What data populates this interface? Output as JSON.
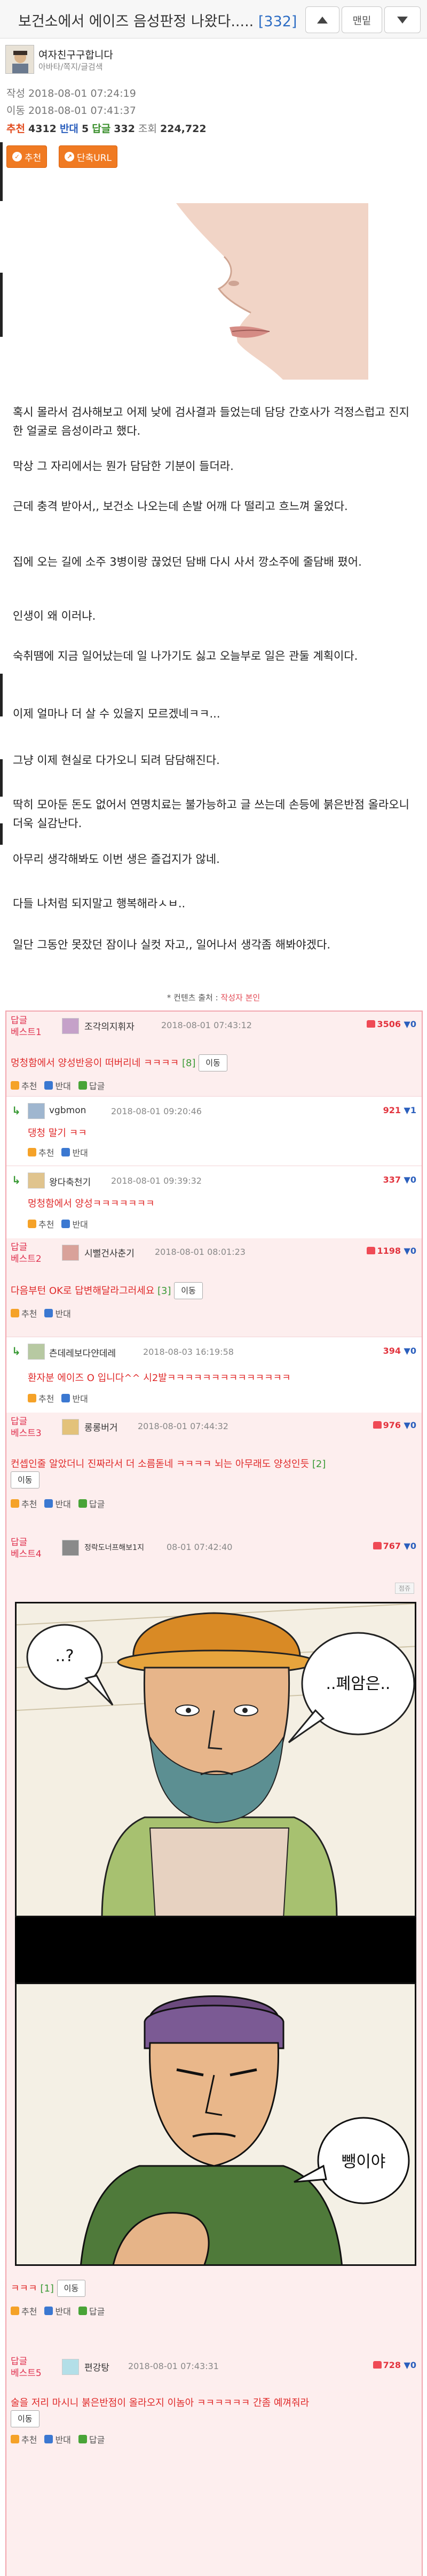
{
  "header": {
    "title": "보건소에서 에이즈 음성판정 나왔다.....",
    "comment_count": "[332]",
    "bottom_button": "맨밑"
  },
  "post": {
    "author": "여자친구구합니다",
    "author_sub": "아바타/쪽지/글검색",
    "created": "작성 2018-08-01 07:24:19",
    "moved": "이동 2018-08-01 07:41:37",
    "stats": {
      "rec_label": "추천",
      "rec_value": "4312",
      "opp_label": "반대",
      "opp_value": "5",
      "reply_label": "답글",
      "reply_value": "332",
      "view_label": "조회",
      "view_value": "224,722"
    },
    "recommend_button": "추천",
    "short_url_button": "단축URL",
    "paragraphs": [
      "혹시 몰라서 검사해보고 어제 낮에 검사결과 들었는데 담당 간호사가 걱정스럽고 진지한 얼굴로 음성이라고 했다.",
      "막상 그 자리에서는 뭔가 담담한 기분이 들더라.",
      "근데 충격 받아서,, 보건소 나오는데 손발 어깨 다 떨리고 흐느껴 울었다.",
      "집에 오는 길에 소주 3병이랑 끊었던 담배 다시 사서 깡소주에 줄담배 폈어.",
      "인생이 왜 이러냐.",
      "숙취땜에 지금 일어났는데 일 나가기도 싫고 오늘부로 일은 관둘 계획이다.",
      "이제 얼마나 더 살 수 있을지 모르겠네ㅋㅋ...",
      "그냥 이제 현실로 다가오니 되려 담담해진다.",
      "딱히 모아둔 돈도 없어서 연명치료는 불가능하고 글 쓰는데 손등에 붉은반점 올라오니 더욱 실감난다.",
      "아무리 생각해봐도 이번 생은 즐겁지가 않네.",
      "다들 나처럼 되지말고 행복해라ㅅㅂ..",
      "일단 그동안 못잤던 잠이나 실컷 자고,, 일어나서 생각좀 해봐야겠다."
    ],
    "source_prefix": "* 컨텐츠 출처 :",
    "source_value": "작성자 본인"
  },
  "labels": {
    "recommend": "추천",
    "oppose": "반대",
    "reply": "답글",
    "move": "이동",
    "report": "점쥬"
  },
  "comments": [
    {
      "best": "답글\n베스트1",
      "name": "조각의지휘자",
      "date": "2018-08-01 07:43:12",
      "up": "3506",
      "down": "0",
      "text": "멍청함에서 양성반응이 떠버리네 ㅋㅋㅋㅋ",
      "count": "[8]",
      "has_reply": true,
      "replies": [
        {
          "name": "vgbmon",
          "date": "2018-08-01 09:20:46",
          "up": "921",
          "down": "1",
          "text": "댕청 말기 ㅋㅋ"
        },
        {
          "name": "왕다축천기",
          "date": "2018-08-01 09:39:32",
          "up": "337",
          "down": "0",
          "text": "멍청함에서 양성ㅋㅋㅋㅋㅋㅋㅋ"
        }
      ]
    },
    {
      "best": "답글\n베스트2",
      "name": "시뻘건사춘기",
      "date": "2018-08-01 08:01:23",
      "up": "1198",
      "down": "0",
      "text": "다음부턴 OK로 답변해달라그러세요",
      "count": "[3]",
      "has_reply": false,
      "replies": [
        {
          "name": "츤데레보다얀데레",
          "date": "2018-08-03 16:19:58",
          "up": "394",
          "down": "0",
          "text": "환자분 에이즈 O 입니다^^ 시2발ㅋㅋㅋㅋㅋㅋㅋㅋㅋㅋㅋㅋㅋㅋ"
        }
      ]
    },
    {
      "best": "답글\n베스트3",
      "name": "롱롱버거",
      "date": "2018-08-01 07:44:32",
      "up": "976",
      "down": "0",
      "text": "컨셉인줄 알았더니 진짜라서 더 소름돋네 ㅋㅋㅋㅋ 뇌는 아무래도 양성인듯",
      "count": "[2]",
      "has_reply": false,
      "replies": []
    },
    {
      "best": "답글\n베스트4",
      "name": "정락도너프해보1지",
      "date": "08-01 07:42:40",
      "up": "767",
      "down": "0",
      "comic_top_left": "..?",
      "comic_top_right": "..폐암은..",
      "comic_bottom": "뺑이야",
      "text": "ㅋㅋㅋ",
      "count": "[1]",
      "has_reply": true,
      "replies": []
    },
    {
      "best": "답글\n베스트5",
      "name": "편강탕",
      "date": "2018-08-01 07:43:31",
      "up": "728",
      "down": "0",
      "text": "술을 저리 마시니 붉은반점이 올라오지 이놈아 ㅋㅋㅋㅋㅋㅋ 간좀 예껴줘라",
      "count": "",
      "has_reply": true,
      "replies": []
    }
  ],
  "colors": {
    "accent_orange": "#f07a22",
    "best_bg": "#fdeeee",
    "comment_border": "#f2a5ae",
    "comment_red": "#e02a2a",
    "count_blue": "#2d6dc4"
  }
}
